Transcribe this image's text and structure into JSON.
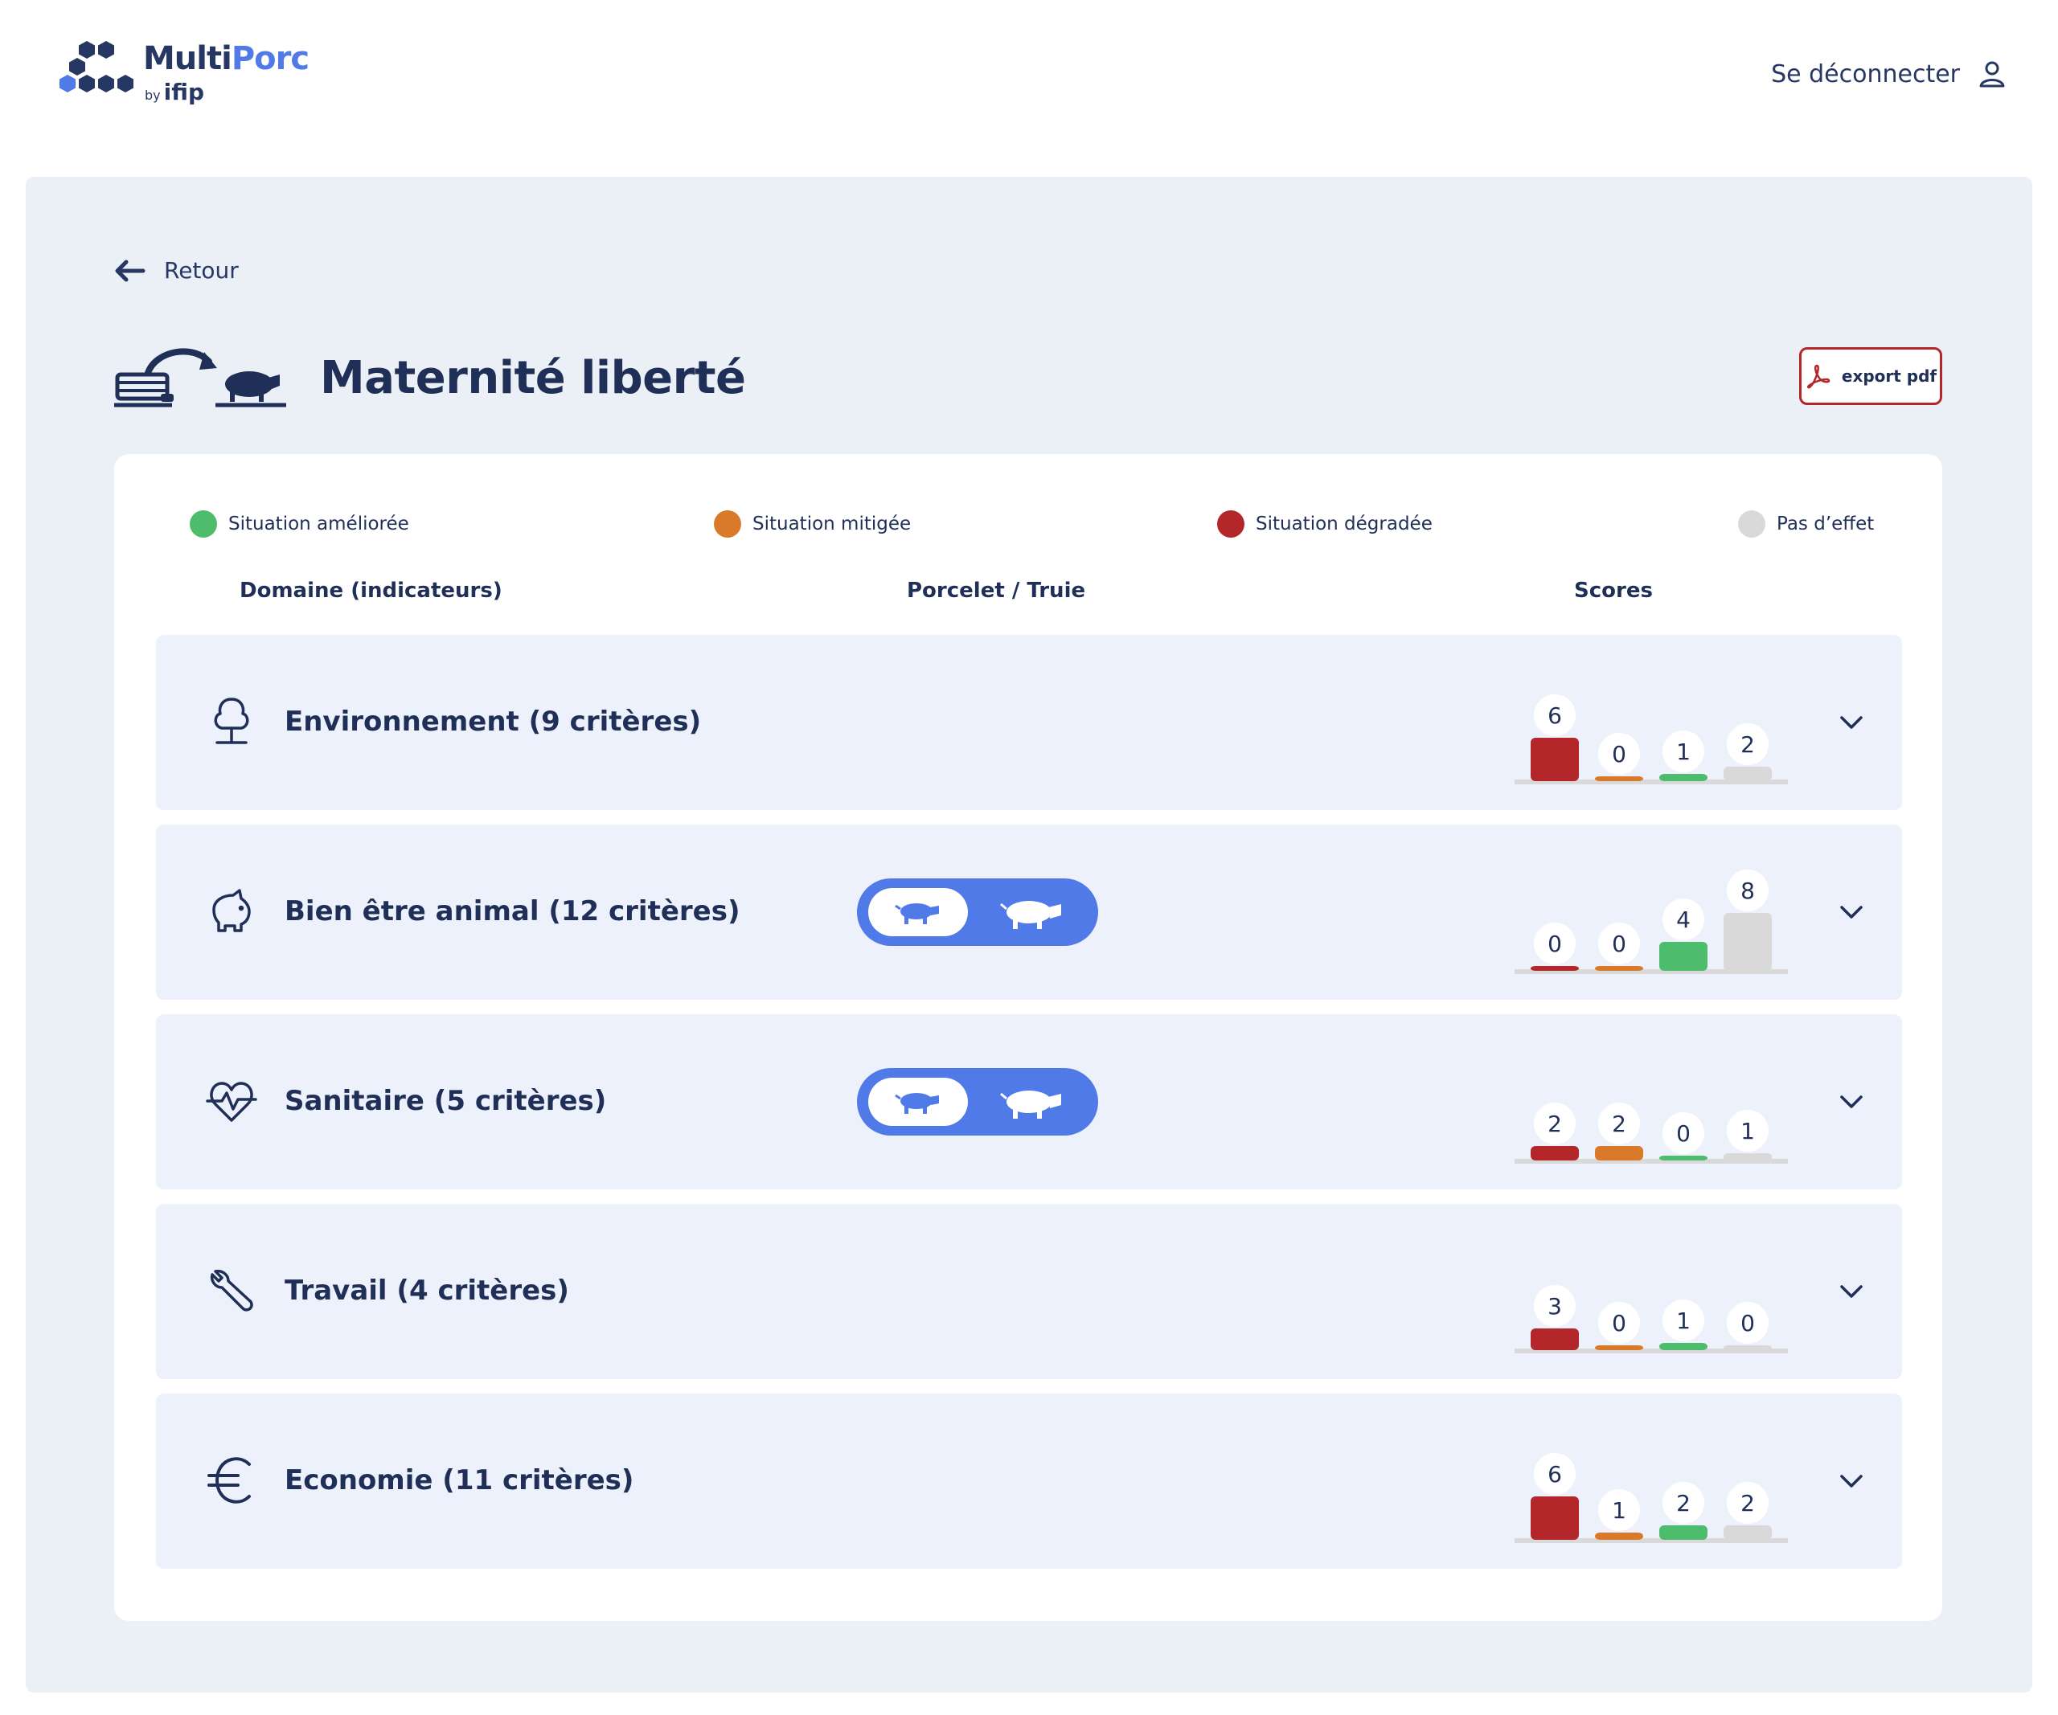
{
  "header": {
    "logo_multi": "Multi",
    "logo_porc": "Porc",
    "logo_by": "by",
    "logo_ifip": "ifip",
    "logout_label": "Se déconnecter"
  },
  "nav": {
    "back_label": "Retour"
  },
  "page": {
    "title": "Maternité liberté",
    "export_label": "export pdf"
  },
  "legend": [
    {
      "label": "Situation améliorée",
      "color": "#4ebc6d"
    },
    {
      "label": "Situation mitigée",
      "color": "#d97a2b"
    },
    {
      "label": "Situation dégradée",
      "color": "#b3262a"
    },
    {
      "label": "Pas d’effet",
      "color": "#d9d9d9"
    }
  ],
  "columns": {
    "domain": "Domaine (indicateurs)",
    "animal": "Porcelet / Truie",
    "scores": "Scores"
  },
  "score_colors": [
    "#b3262a",
    "#d97a2b",
    "#4ebc6d",
    "#d9d9d9"
  ],
  "rows": [
    {
      "label": "Environnement (9 critères)",
      "icon": "tree-icon",
      "has_toggle": false,
      "scores": [
        6,
        0,
        1,
        2
      ]
    },
    {
      "label": "Bien être animal (12 critères)",
      "icon": "piggy-icon",
      "has_toggle": true,
      "scores": [
        0,
        0,
        4,
        8
      ]
    },
    {
      "label": "Sanitaire (5 critères)",
      "icon": "heart-pulse-icon",
      "has_toggle": true,
      "scores": [
        2,
        2,
        0,
        1
      ]
    },
    {
      "label": "Travail (4 critères)",
      "icon": "wrench-icon",
      "has_toggle": false,
      "scores": [
        3,
        0,
        1,
        0
      ]
    },
    {
      "label": "Economie (11 critères)",
      "icon": "euro-icon",
      "has_toggle": false,
      "scores": [
        6,
        1,
        2,
        2
      ]
    }
  ],
  "chart_data": {
    "type": "bar",
    "categories": [
      "Environnement",
      "Bien être animal",
      "Sanitaire",
      "Travail",
      "Economie"
    ],
    "series": [
      {
        "name": "Situation dégradée",
        "values": [
          6,
          0,
          2,
          3,
          6
        ]
      },
      {
        "name": "Situation mitigée",
        "values": [
          0,
          0,
          2,
          0,
          1
        ]
      },
      {
        "name": "Situation améliorée",
        "values": [
          1,
          4,
          0,
          1,
          2
        ]
      },
      {
        "name": "Pas d’effet",
        "values": [
          2,
          8,
          1,
          0,
          2
        ]
      }
    ]
  }
}
